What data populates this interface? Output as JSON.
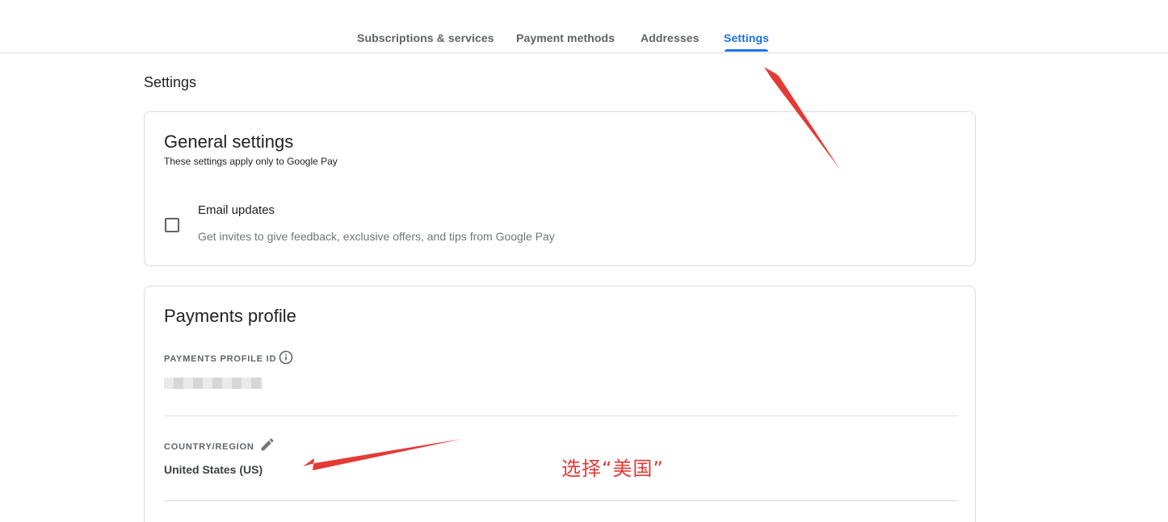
{
  "tabs": [
    {
      "label": "Subscriptions & services",
      "active": false
    },
    {
      "label": "Payment methods",
      "active": false
    },
    {
      "label": "Addresses",
      "active": false
    },
    {
      "label": "Settings",
      "active": true
    }
  ],
  "page_title": "Settings",
  "general": {
    "title": "General settings",
    "subtitle": "These settings apply only to Google Pay",
    "email_updates": {
      "label": "Email updates",
      "description": "Get invites to give feedback, exclusive offers, and tips from Google Pay",
      "checked": false
    }
  },
  "payments": {
    "title": "Payments profile",
    "profile_id_label": "PAYMENTS PROFILE ID",
    "country_label": "COUNTRY/REGION",
    "country_value": "United States (US)"
  },
  "annotation": {
    "text": "选择“美国”",
    "color": "#e53935"
  },
  "colors": {
    "accent": "#1a73e8",
    "annotation": "#e53935"
  },
  "icons": [
    "info-icon",
    "edit-pencil-icon",
    "checkbox-icon"
  ]
}
